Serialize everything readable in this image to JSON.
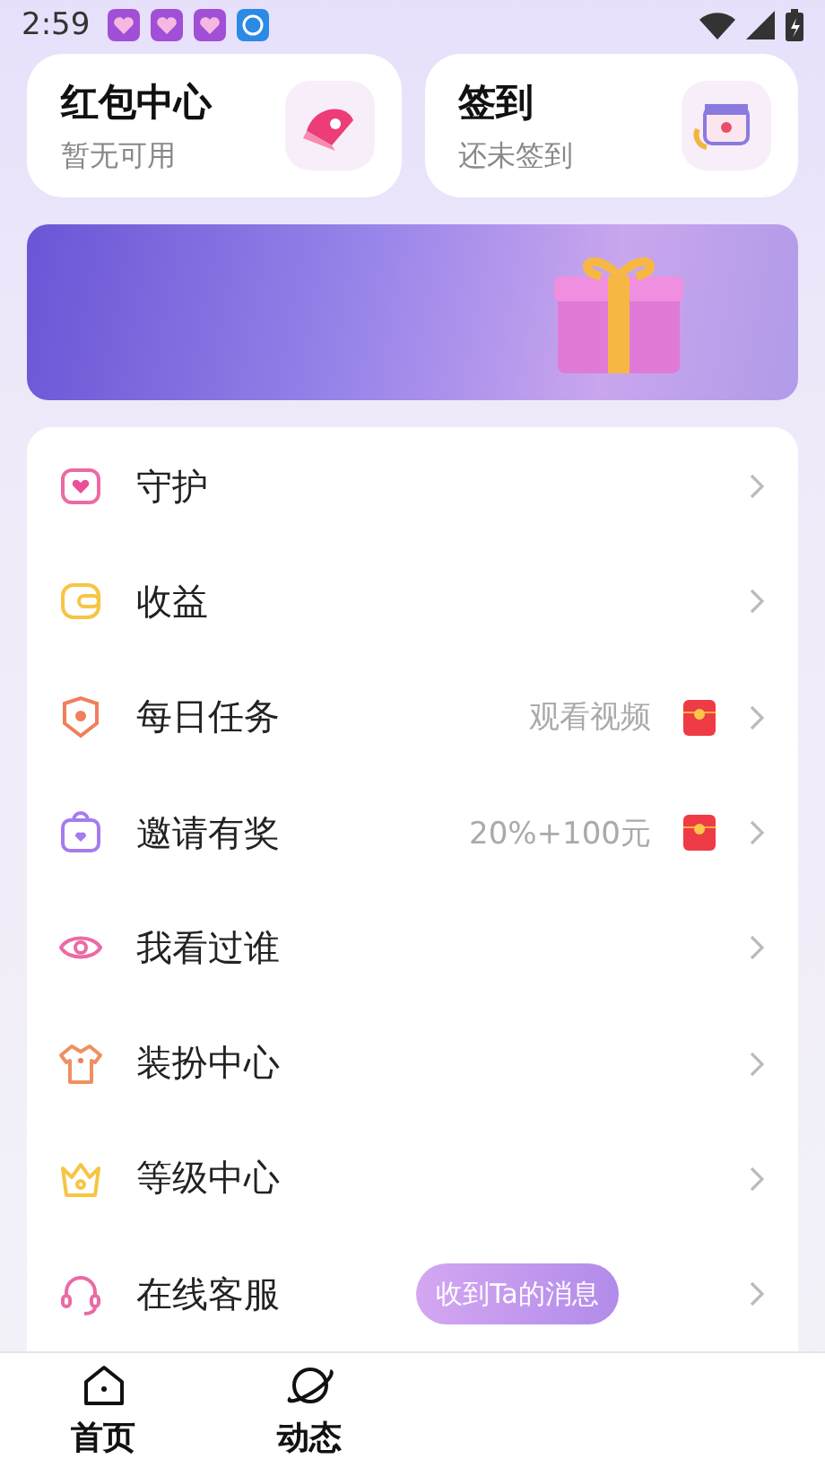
{
  "status_bar": {
    "time": "2:59"
  },
  "cards": [
    {
      "title": "红包中心",
      "subtitle": "暂无可用"
    },
    {
      "title": "签到",
      "subtitle": "还未签到"
    }
  ],
  "menu": [
    {
      "label": "守护"
    },
    {
      "label": "收益"
    },
    {
      "label": "每日任务",
      "hint": "观看视频"
    },
    {
      "label": "邀请有奖",
      "hint": "20%+100元"
    },
    {
      "label": "我看过谁"
    },
    {
      "label": "装扮中心"
    },
    {
      "label": "等级中心"
    },
    {
      "label": "在线客服",
      "tooltip": "收到Ta的消息"
    }
  ],
  "nav": [
    {
      "label": "首页"
    },
    {
      "label": "动态"
    }
  ]
}
